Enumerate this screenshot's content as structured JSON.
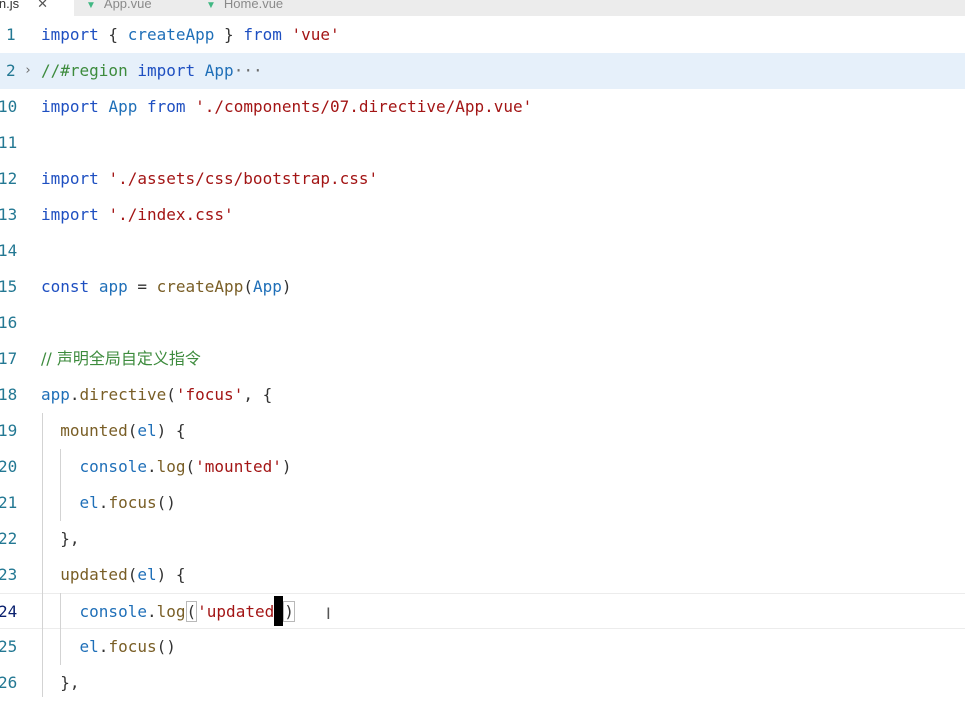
{
  "tabs": [
    {
      "label": "in.js",
      "close": "✕",
      "active": true
    },
    {
      "label": "App.vue",
      "active": false
    },
    {
      "label": "Home.vue",
      "active": false
    }
  ],
  "lines": [
    {
      "num": "1",
      "code": "import { createApp } from 'vue'"
    },
    {
      "num": "2",
      "code": "//#region import App",
      "fold": "›",
      "ellipsis": "···"
    },
    {
      "num": "10",
      "code": "import App from './components/07.directive/App.vue'"
    },
    {
      "num": "11",
      "code": ""
    },
    {
      "num": "12",
      "code": "import './assets/css/bootstrap.css'"
    },
    {
      "num": "13",
      "code": "import './index.css'"
    },
    {
      "num": "14",
      "code": ""
    },
    {
      "num": "15",
      "code": "const app = createApp(App)"
    },
    {
      "num": "16",
      "code": ""
    },
    {
      "num": "17",
      "code": "// 声明全局自定义指令"
    },
    {
      "num": "18",
      "code": "app.directive('focus', {"
    },
    {
      "num": "19",
      "code": "  mounted(el) {"
    },
    {
      "num": "20",
      "code": "    console.log('mounted')"
    },
    {
      "num": "21",
      "code": "    el.focus()"
    },
    {
      "num": "22",
      "code": "  },"
    },
    {
      "num": "23",
      "code": "  updated(el) {"
    },
    {
      "num": "24",
      "code": "    console.log('updated')"
    },
    {
      "num": "25",
      "code": "    el.focus()"
    },
    {
      "num": "26",
      "code": "  },"
    }
  ]
}
